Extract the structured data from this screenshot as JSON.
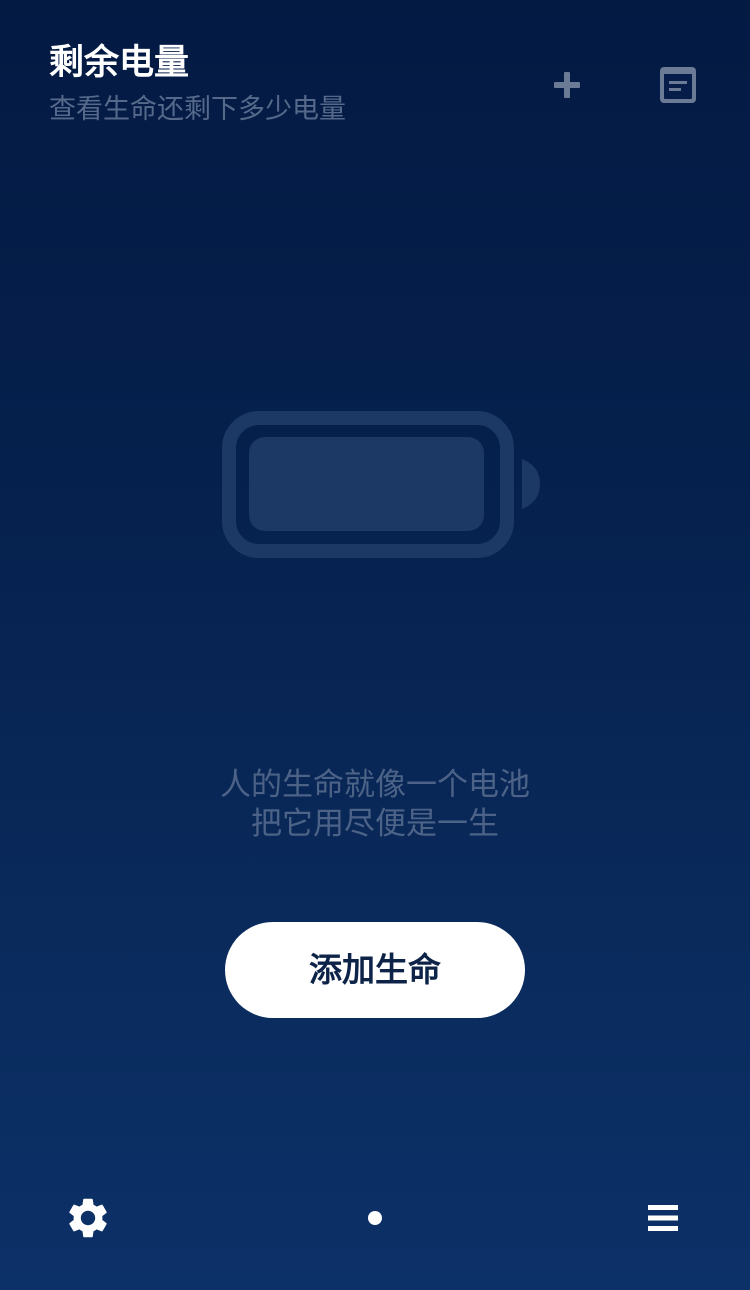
{
  "header": {
    "title": "剩余电量",
    "subtitle": "查看生命还剩下多少电量",
    "actions": [
      {
        "icon": "plus-icon"
      },
      {
        "icon": "notes-icon"
      }
    ]
  },
  "empty_state": {
    "illustration": "battery-icon",
    "quote_line_1": "人的生命就像一个电池",
    "quote_line_2": "把它用尽便是一生",
    "button_label": "添加生命"
  },
  "bottom_bar": {
    "left_icon": "gear-icon",
    "right_icon": "menu-icon",
    "page_indicator": {
      "current": 1,
      "total": 1
    }
  },
  "colors": {
    "background_top": "#031a43",
    "background_bottom": "#0c3168",
    "subtitle": "#56698a",
    "quote": "#4c6286",
    "button_bg": "#ffffff",
    "button_text": "#0d2448",
    "battery": "#1c3865",
    "icon_muted": "#6b7b95"
  }
}
